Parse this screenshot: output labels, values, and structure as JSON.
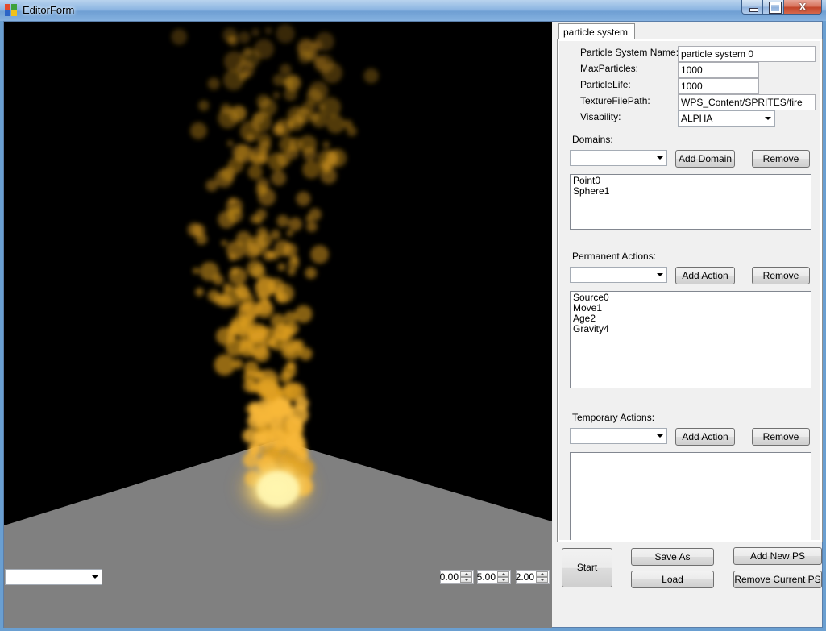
{
  "window": {
    "title": "EditorForm",
    "close_glyph": "X"
  },
  "viewport": {
    "preset_select": {
      "value": ""
    },
    "spinners": [
      {
        "value": "0.00"
      },
      {
        "value": "5.00"
      },
      {
        "value": "2.00"
      }
    ]
  },
  "tab": {
    "label": "particle system 0"
  },
  "properties": {
    "name_label": "Particle System Name:",
    "name_value": "particle system 0",
    "max_particles_label": "MaxParticles:",
    "max_particles_value": "1000",
    "particle_life_label": "ParticleLife:",
    "particle_life_value": "1000",
    "texture_label": "TextureFilePath:",
    "texture_value": "WPS_Content/SPRITES/fire",
    "visability_label": "Visability:",
    "visability_value": "ALPHA"
  },
  "domains": {
    "label": "Domains:",
    "select_value": "",
    "add_label": "Add Domain",
    "remove_label": "Remove",
    "items": [
      "Point0",
      "Sphere1"
    ]
  },
  "permanent_actions": {
    "label": "Permanent Actions:",
    "select_value": "",
    "add_label": "Add Action",
    "remove_label": "Remove",
    "items": [
      "Source0",
      "Move1",
      "Age2",
      "Gravity4"
    ]
  },
  "temporary_actions": {
    "label": "Temporary Actions:",
    "select_value": "",
    "add_label": "Add Action",
    "remove_label": "Remove",
    "items": []
  },
  "bottom_buttons": {
    "start": "Start",
    "save_as": "Save As",
    "load": "Load",
    "add_new_ps": "Add New PS",
    "remove_current_ps": "Remove Current PS"
  },
  "colors": {
    "viewport_background": "#000000",
    "ground": "#808080",
    "particle": "#e0a020",
    "flame_core": "#fff3a0",
    "titlebar": "#8db6e2"
  }
}
